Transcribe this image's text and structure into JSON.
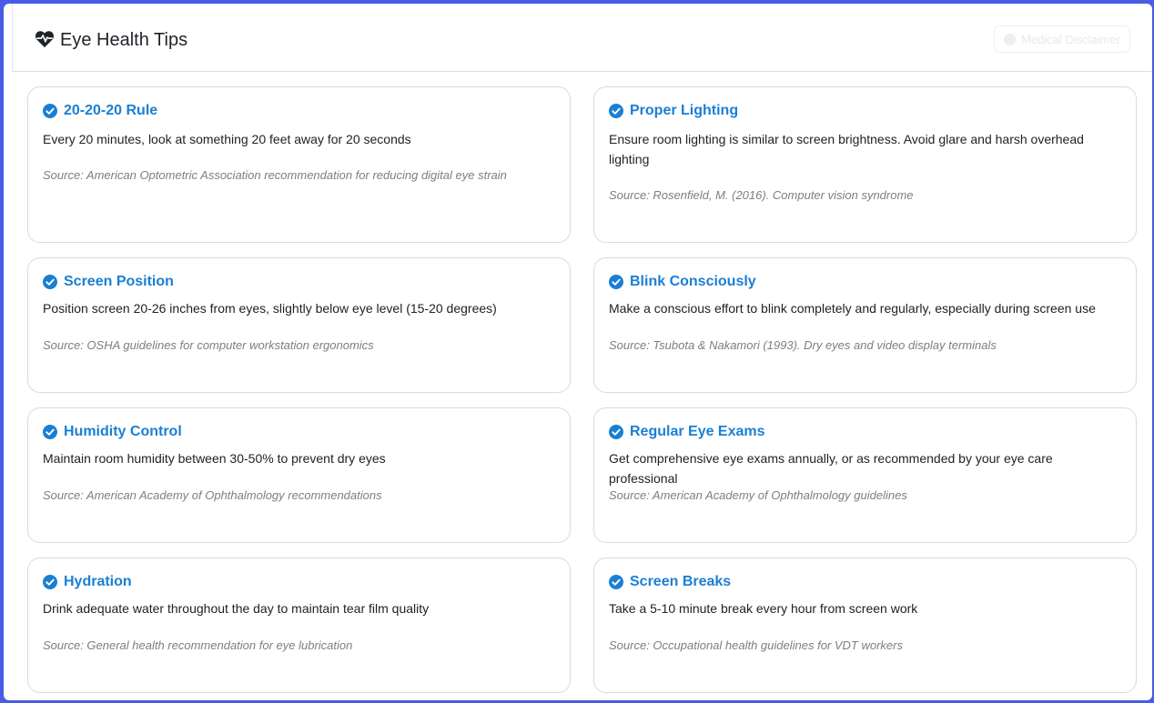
{
  "header": {
    "title": "Eye Health Tips",
    "icon": "heart-pulse-icon",
    "disclaimer_label": "Medical Disclaimer"
  },
  "colors": {
    "frame": "#4a5be6",
    "title_blue": "#1a7fd4",
    "check_blue": "#1a7fd4"
  },
  "tips": [
    {
      "title": "20-20-20 Rule",
      "description": "Every 20 minutes, look at something 20 feet away for 20 seconds",
      "source": "Source: American Optometric Association recommendation for reducing digital eye strain"
    },
    {
      "title": "Proper Lighting",
      "description": "Ensure room lighting is similar to screen brightness. Avoid glare and harsh overhead lighting",
      "source": "Source: Rosenfield, M. (2016). Computer vision syndrome"
    },
    {
      "title": "Screen Position",
      "description": "Position screen 20-26 inches from eyes, slightly below eye level (15-20 degrees)",
      "source": "Source: OSHA guidelines for computer workstation ergonomics"
    },
    {
      "title": "Blink Consciously",
      "description": "Make a conscious effort to blink completely and regularly, especially during screen use",
      "source": "Source: Tsubota & Nakamori (1993). Dry eyes and video display terminals"
    },
    {
      "title": "Humidity Control",
      "description": "Maintain room humidity between 30-50% to prevent dry eyes",
      "source": "Source: American Academy of Ophthalmology recommendations"
    },
    {
      "title": "Regular Eye Exams",
      "description": "Get comprehensive eye exams annually, or as recommended by your eye care professional",
      "source": "Source: American Academy of Ophthalmology guidelines"
    },
    {
      "title": "Hydration",
      "description": "Drink adequate water throughout the day to maintain tear film quality",
      "source": "Source: General health recommendation for eye lubrication"
    },
    {
      "title": "Screen Breaks",
      "description": "Take a 5-10 minute break every hour from screen work",
      "source": "Source: Occupational health guidelines for VDT workers"
    }
  ]
}
